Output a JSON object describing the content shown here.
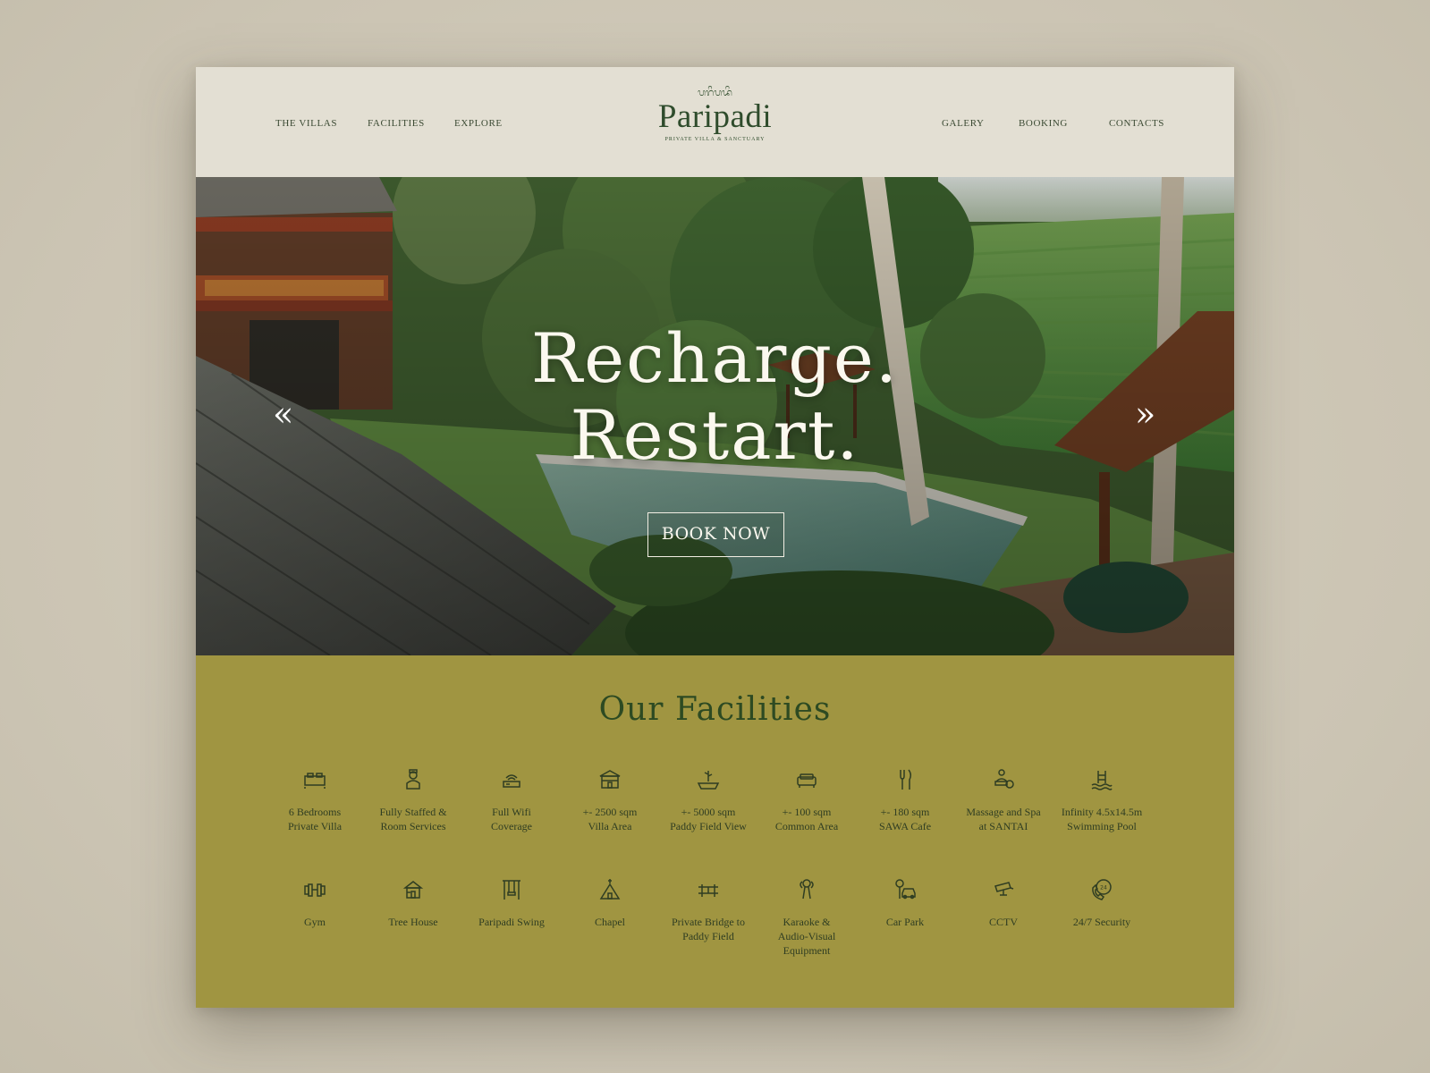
{
  "header": {
    "nav_left": [
      "THE VILLAS",
      "FACILITIES",
      "EXPLORE"
    ],
    "nav_right": [
      "GALERY",
      "BOOKING",
      "CONTACTS"
    ],
    "logo": {
      "script": "ᬧᬭᬶᬧᬤᬶ",
      "name": "Paripadi",
      "tagline": "PRIVATE VILLA & SANCTUARY"
    }
  },
  "hero": {
    "line1": "Recharge.",
    "line2": "Restart.",
    "prev": "«",
    "next": "»",
    "cta": "BOOK NOW"
  },
  "facilities": {
    "title": "Our Facilities",
    "items": [
      {
        "label": "6 Bedrooms\nPrivate Villa",
        "icon": "bed-icon"
      },
      {
        "label": "Fully Staffed &\nRoom Services",
        "icon": "staff-icon"
      },
      {
        "label": "Full Wifi\nCoverage",
        "icon": "wifi-icon"
      },
      {
        "label": "+- 2500 sqm\nVilla Area",
        "icon": "villa-icon"
      },
      {
        "label": "+- 5000 sqm\nPaddy Field View",
        "icon": "paddy-icon"
      },
      {
        "label": "+- 100 sqm\nCommon Area",
        "icon": "sofa-icon"
      },
      {
        "label": "+- 180 sqm\nSAWA Cafe",
        "icon": "cutlery-icon"
      },
      {
        "label": "Massage and Spa\nat SANTAI",
        "icon": "spa-icon"
      },
      {
        "label": "Infinity 4.5x14.5m\nSwimming Pool",
        "icon": "pool-icon"
      },
      {
        "label": "Gym",
        "icon": "dumbbell-icon"
      },
      {
        "label": "Tree House",
        "icon": "treehouse-icon"
      },
      {
        "label": "Paripadi Swing",
        "icon": "swing-icon"
      },
      {
        "label": "Chapel",
        "icon": "chapel-icon"
      },
      {
        "label": "Private Bridge to\nPaddy Field",
        "icon": "bridge-icon"
      },
      {
        "label": "Karaoke &\nAudio-Visual\nEquipment",
        "icon": "microphone-icon"
      },
      {
        "label": "Car Park",
        "icon": "car-park-icon"
      },
      {
        "label": "CCTV",
        "icon": "cctv-icon"
      },
      {
        "label": "24/7 Security",
        "icon": "phone-24-icon"
      }
    ]
  },
  "colors": {
    "header_bg": "#e3dfd3",
    "brand_green": "#2f4c2c",
    "facilities_bg": "#a09541",
    "page_bg": "#cfc8b7"
  }
}
